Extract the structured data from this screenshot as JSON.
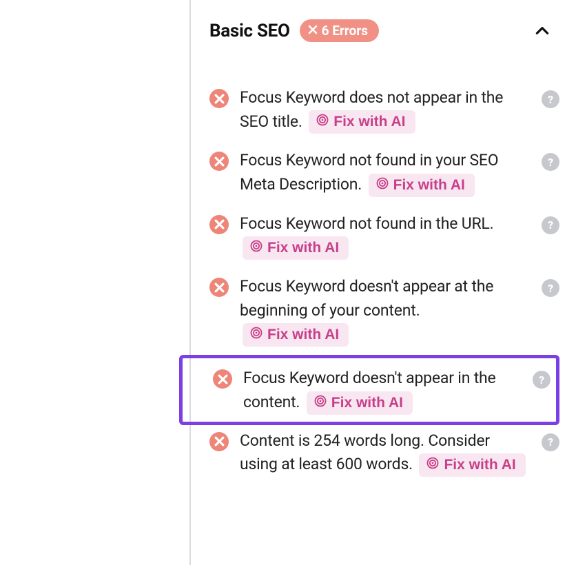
{
  "section": {
    "title": "Basic SEO",
    "errorCount": "6 Errors"
  },
  "fixLabel": "Fix with AI",
  "items": [
    {
      "text": "Focus Keyword does not appear in the SEO title.",
      "highlight": false
    },
    {
      "text": "Focus Keyword not found in your SEO Meta Description.",
      "highlight": false
    },
    {
      "text": "Focus Keyword not found in the URL.",
      "highlight": false
    },
    {
      "text": "Focus Keyword doesn't appear at the beginning of your content.",
      "highlight": false
    },
    {
      "text": "Focus Keyword doesn't appear in the content.",
      "highlight": true
    },
    {
      "text": "Content is 254 words long. Consider using at least 600 words.",
      "highlight": false
    }
  ]
}
